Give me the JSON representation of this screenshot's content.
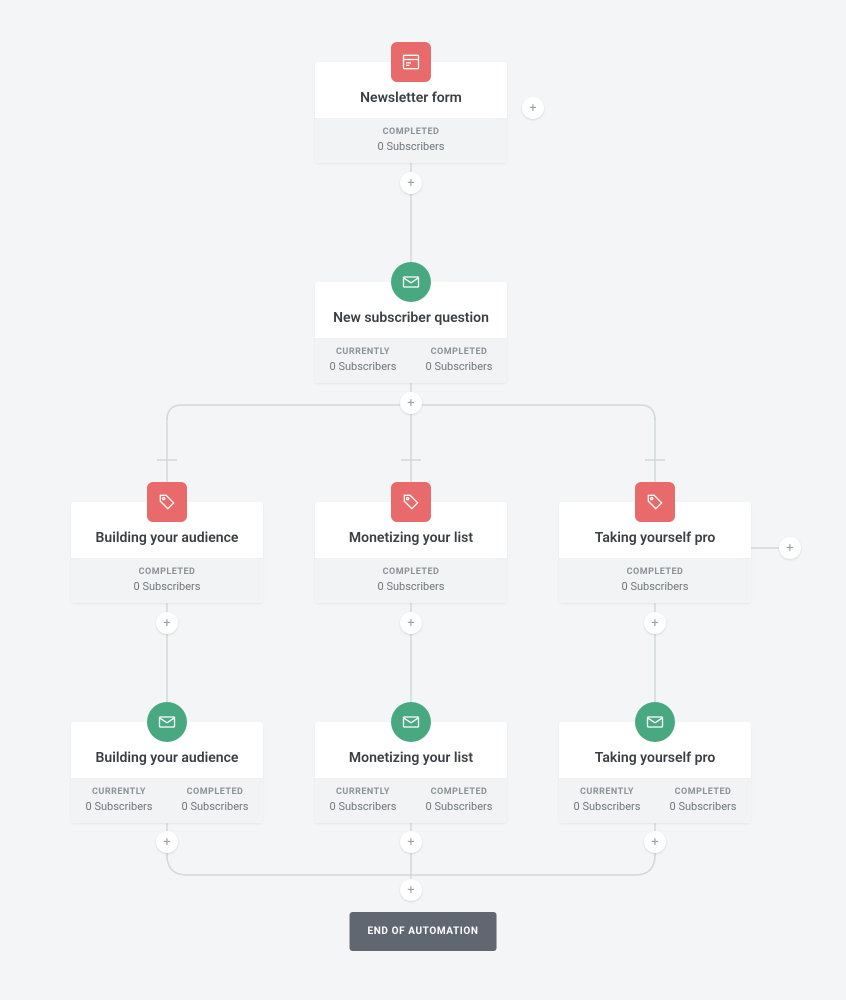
{
  "labels": {
    "completed": "COMPLETED",
    "currently": "CURRENTLY",
    "zero_subs": "0 Subscribers",
    "end": "END OF AUTOMATION"
  },
  "nodes": {
    "n1": {
      "title": "Newsletter form"
    },
    "n2": {
      "title": "New subscriber question"
    },
    "n3": {
      "title": "Building your audience"
    },
    "n4": {
      "title": "Monetizing your list"
    },
    "n5": {
      "title": "Taking yourself pro"
    },
    "n6": {
      "title": "Building your audience"
    },
    "n7": {
      "title": "Monetizing your list"
    },
    "n8": {
      "title": "Taking yourself pro"
    }
  }
}
